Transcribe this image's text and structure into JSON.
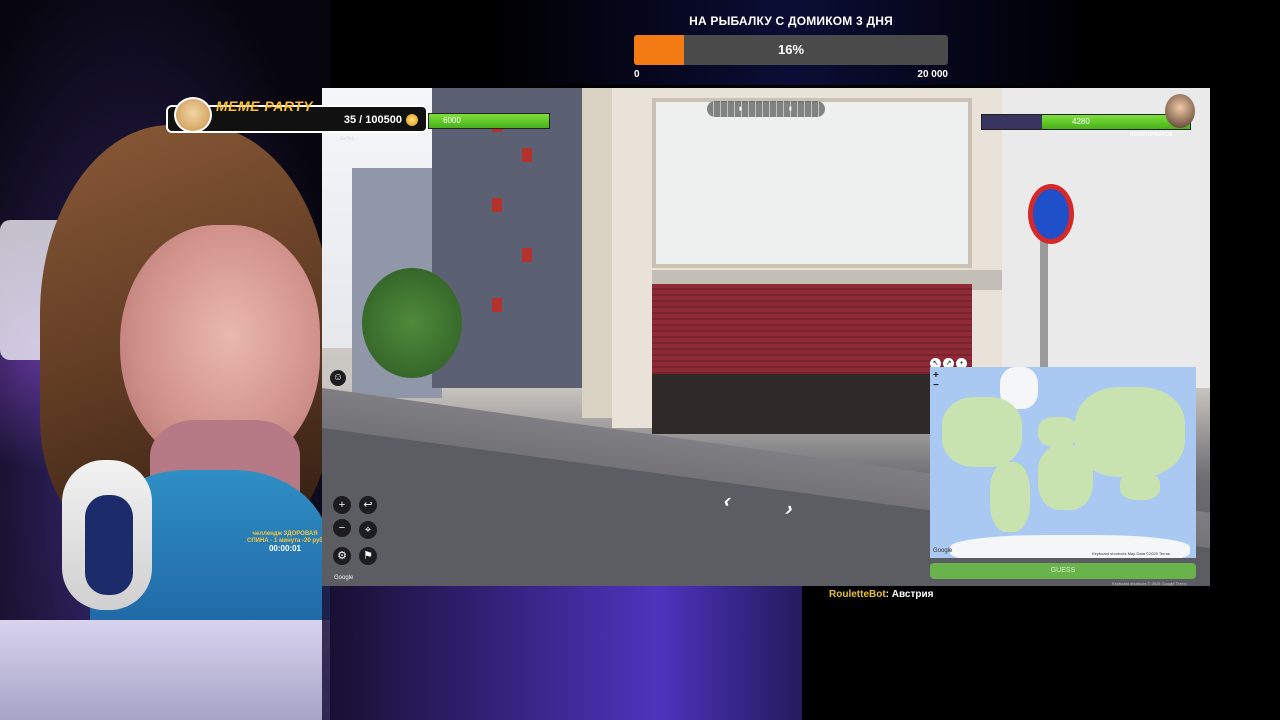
{
  "goal": {
    "title": "НА РЫБАЛКУ С ДОМИКОМ 3 ДНЯ",
    "progress_fraction": 0.16,
    "percent_label": "16%",
    "min_label": "0",
    "max_label": "20 000",
    "accent": "#f47a14"
  },
  "meme_party": {
    "title": "MEME PARTY",
    "count": "35 / 100500",
    "icon": "doge-icon"
  },
  "challenge": {
    "line1": "челлендж ЗДОРОВАЯ",
    "line2": "СПИНА - 1 минута -20 руб",
    "timer": "00:00:01"
  },
  "hud": {
    "left_hp": "6000",
    "left_hp_fraction": 1.0,
    "right_hp": "4280",
    "right_hp_fraction": 0.71,
    "left_player": "Gellab",
    "right_player": "ROARTEPRAKOS"
  },
  "controls": {
    "zoom_in": "+",
    "zoom_out": "−",
    "undo": "↩",
    "pin": "⌖",
    "settings": "⚙",
    "flag": "⚑",
    "emote": "☺",
    "google": "Google"
  },
  "map": {
    "zoom_in": "+",
    "zoom_out": "−",
    "google": "Google",
    "footer": "Keyboard shortcuts   Map Data ©2025   Terms",
    "guess_label": "GUESS",
    "terms": "Keyboard shortcuts  © 2025 Google  Terms"
  },
  "chat": {
    "user": "RouletteBot",
    "message": ": Австрия"
  }
}
